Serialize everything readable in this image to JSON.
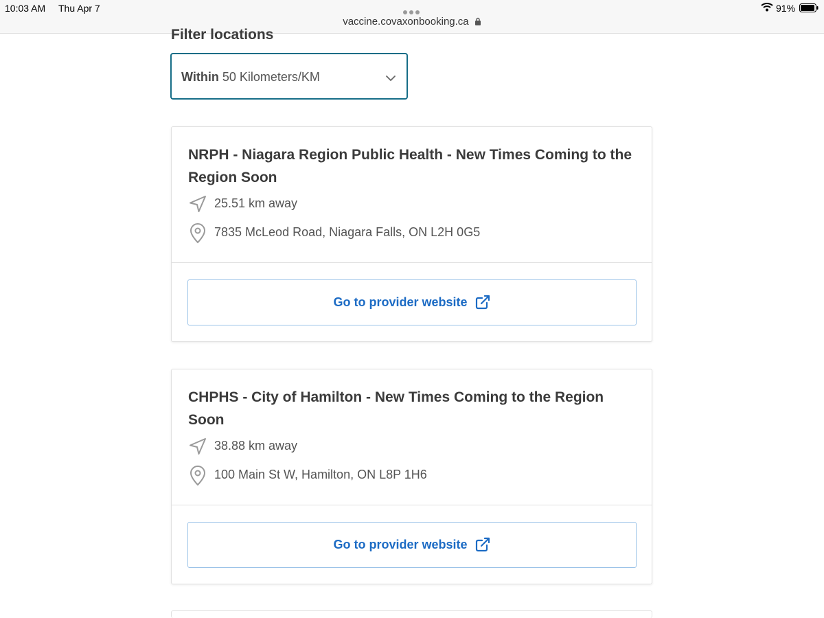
{
  "status_bar": {
    "time": "10:03 AM",
    "date": "Thu Apr 7",
    "url": "vaccine.covaxonbooking.ca",
    "battery": "91%"
  },
  "filter": {
    "title": "Filter locations",
    "select_prefix": "Within",
    "select_value": "50 Kilometers/KM"
  },
  "locations": [
    {
      "title": "NRPH - Niagara Region Public Health - New Times Coming to the Region Soon",
      "distance": "25.51 km away",
      "address": "7835 McLeod Road, Niagara Falls, ON L2H 0G5",
      "button": "Go to provider website"
    },
    {
      "title": "CHPHS - City of Hamilton - New Times Coming to the Region Soon",
      "distance": "38.88 km away",
      "address": "100 Main St W, Hamilton, ON L8P 1H6",
      "button": "Go to provider website"
    }
  ],
  "colors": {
    "accent_border": "#166d87",
    "link_blue": "#1c6bc4",
    "button_border": "#9cc3e8"
  },
  "icons": [
    "wifi-icon",
    "battery-icon",
    "lock-icon",
    "chevron-down-icon",
    "navigation-arrow-icon",
    "map-pin-icon",
    "external-link-icon"
  ]
}
